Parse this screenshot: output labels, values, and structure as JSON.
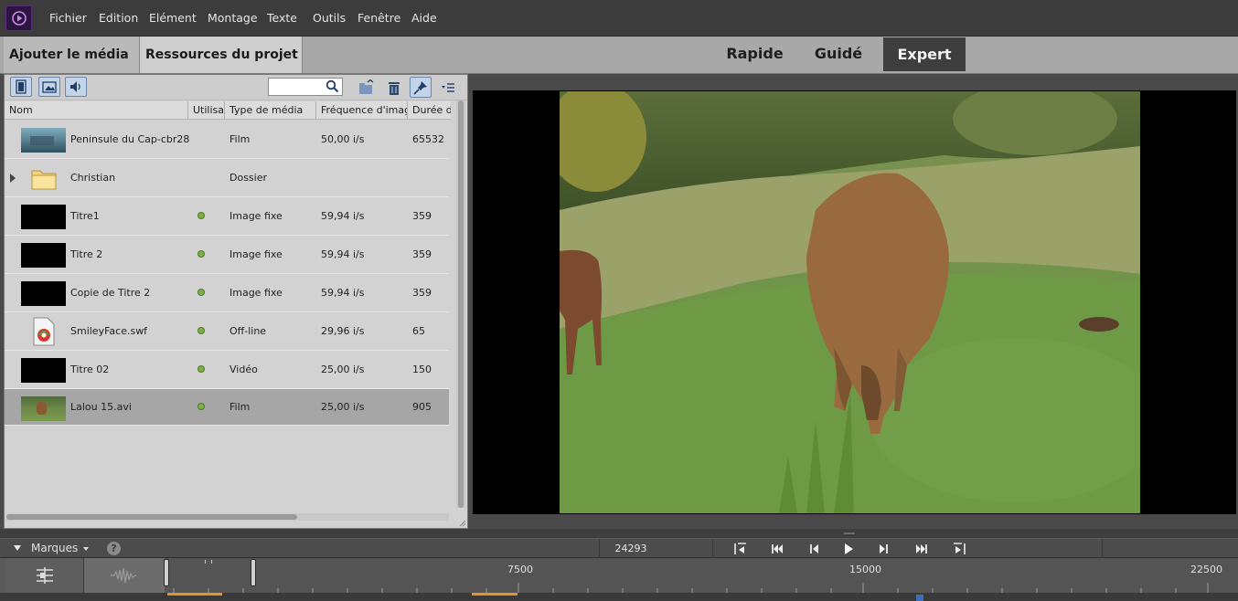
{
  "menu": [
    "Fichier",
    "Edition",
    "Elément",
    "Montage",
    "Texte",
    "Outils",
    "Fenêtre",
    "Aide"
  ],
  "modebar": {
    "add_media": "Ajouter le média",
    "project_assets": "Ressources du projet",
    "tabs": [
      "Rapide",
      "Guidé",
      "Expert"
    ],
    "active_tab": "Expert"
  },
  "media_panel": {
    "search_placeholder": "",
    "columns": [
      "Nom",
      "Utilisati",
      "Type de média",
      "Fréquence d'image",
      "Durée d"
    ],
    "rows": [
      {
        "name": "Peninsule du Cap-cbr28.",
        "used": false,
        "type": "Film",
        "rate": "50,00 i/s",
        "duration": "65532",
        "thumb": "landscape-thumbnail"
      },
      {
        "name": "Christian",
        "used": false,
        "type": "Dossier",
        "rate": "",
        "duration": "",
        "thumb": "folder-icon"
      },
      {
        "name": "Titre1",
        "used": true,
        "type": "Image fixe",
        "rate": "59,94 i/s",
        "duration": "359",
        "thumb": "black-thumbnail"
      },
      {
        "name": "Titre 2",
        "used": true,
        "type": "Image fixe",
        "rate": "59,94 i/s",
        "duration": "359",
        "thumb": "black-thumbnail"
      },
      {
        "name": "Copie de Titre 2",
        "used": true,
        "type": "Image fixe",
        "rate": "59,94 i/s",
        "duration": "359",
        "thumb": "black-thumbnail"
      },
      {
        "name": "SmileyFace.swf",
        "used": true,
        "type": "Off-line",
        "rate": "29,96 i/s",
        "duration": "65",
        "thumb": "swf-file-icon"
      },
      {
        "name": "Titre 02",
        "used": true,
        "type": "Vidéo",
        "rate": "25,00 i/s",
        "duration": "150",
        "thumb": "black-thumbnail"
      },
      {
        "name": "Lalou 15.avi",
        "used": true,
        "type": "Film",
        "rate": "25,00 i/s",
        "duration": "905",
        "thumb": "llama-thumbnail",
        "selected": true
      }
    ]
  },
  "transport": {
    "markers_label": "Marques",
    "help": "?",
    "timecode": "24293"
  },
  "timeline": {
    "ruler_labels": [
      "7500",
      "15000",
      "22500"
    ]
  },
  "colors": {
    "used_dot": "#7cb04a",
    "active_tab_bg": "#3e3e3e",
    "selection_bg": "#a6a6a6",
    "timeline_marker": "#e4932a"
  }
}
